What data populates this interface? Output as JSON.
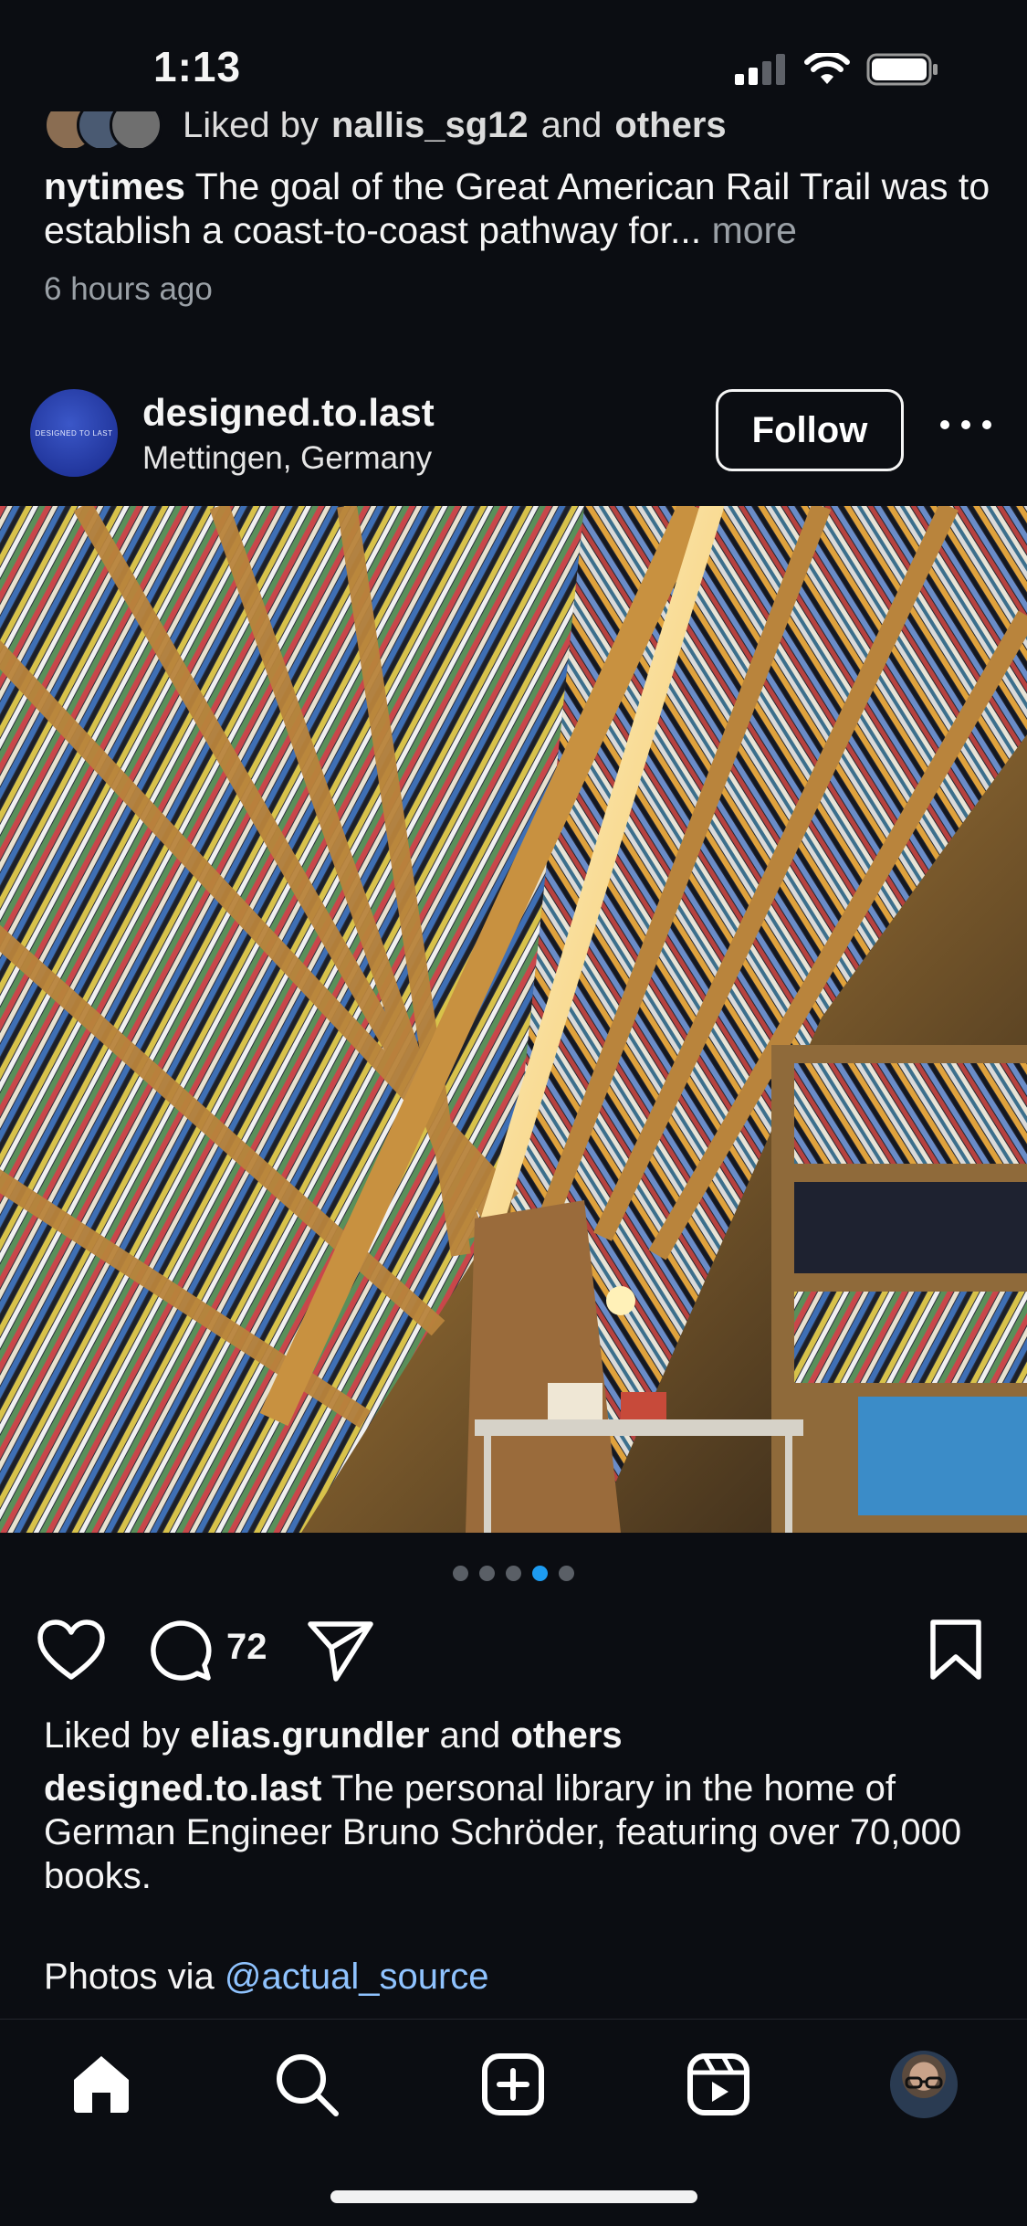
{
  "status_bar": {
    "time": "1:13"
  },
  "previous_post": {
    "liked_by_text": "Liked by",
    "liked_by_user": "nallis_sg12",
    "liked_and": "and",
    "liked_others": "others",
    "username": "nytimes",
    "caption": "The goal of the Great American Rail Trail was to establish a coast-to-coast pathway for...",
    "more_label": "more",
    "timestamp": "6 hours ago"
  },
  "post": {
    "avatar_text": "DESIGNED TO LAST",
    "username": "designed.to.last",
    "location": "Mettingen, Germany",
    "follow_label": "Follow",
    "carousel": {
      "count": 5,
      "active_index": 3
    },
    "comment_count": "72",
    "liked_by_prefix": "Liked by",
    "liked_by_user": "elias.grundler",
    "liked_by_and": "and",
    "liked_by_others": "others",
    "caption_user": "designed.to.last",
    "caption": "The personal library in the home of German Engineer Bruno Schröder, featuring over 70,000 books.",
    "photos_via_prefix": "Photos via",
    "photos_via_mention": "@actual_source"
  },
  "icons": {
    "like": "heart-icon",
    "comment": "comment-bubble-icon",
    "share": "paper-plane-icon",
    "save": "bookmark-icon",
    "more": "ellipsis-icon"
  },
  "bottom_nav": [
    {
      "name": "home",
      "icon": "home-icon",
      "active": true
    },
    {
      "name": "search",
      "icon": "search-icon"
    },
    {
      "name": "create",
      "icon": "plus-square-icon"
    },
    {
      "name": "reels",
      "icon": "reels-icon"
    },
    {
      "name": "profile",
      "icon": "profile-avatar"
    }
  ],
  "colors": {
    "background": "#0b0d12",
    "text": "#f5f5f5",
    "muted": "#9aa0a6",
    "mention": "#8fc3ff",
    "active_dot": "#1d9bf0"
  }
}
